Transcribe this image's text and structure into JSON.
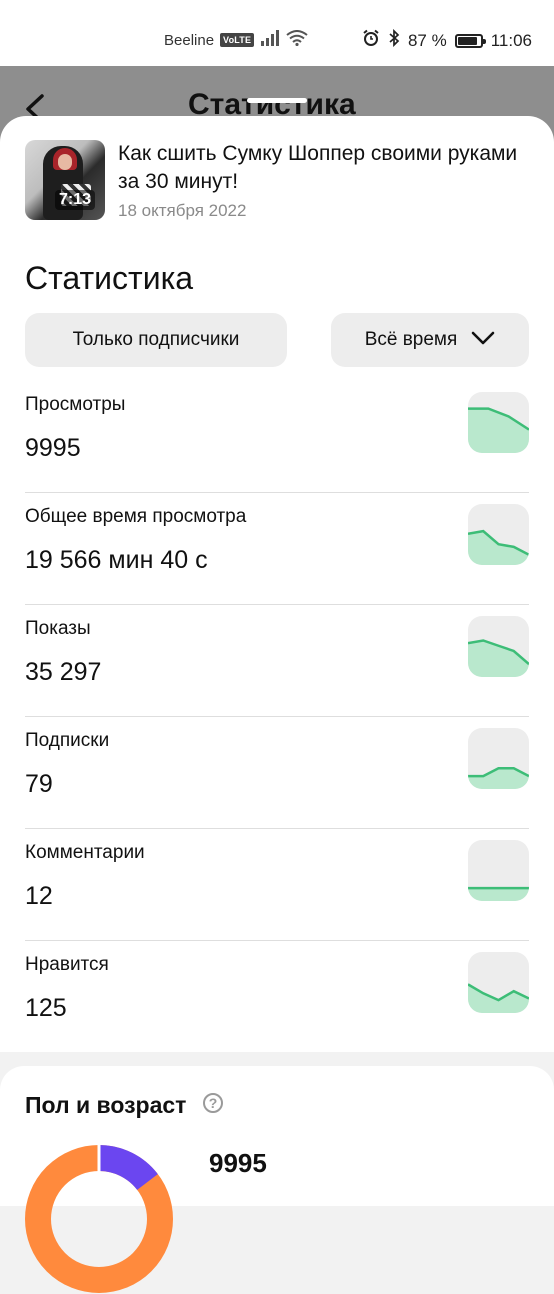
{
  "status_bar": {
    "carrier": "Beeline",
    "volte": "VoLTE",
    "battery": "87 %",
    "battery_level": 0.87,
    "time": "11:06"
  },
  "header": {
    "title": "Статистика"
  },
  "video": {
    "title": "Как сшить Сумку Шоппер своими руками за 30 минут!",
    "date": "18 октября 2022",
    "duration": "7:13"
  },
  "stats": {
    "title": "Статистика",
    "filter_audience": "Только подписчики",
    "filter_period": "Всё время",
    "items": [
      {
        "label": "Просмотры",
        "value": "9995",
        "trend": [
          0.75,
          0.75,
          0.6,
          0.35
        ]
      },
      {
        "label": "Общее время просмотра",
        "value": "19 566 мин 40 с",
        "trend": [
          0.5,
          0.55,
          0.3,
          0.25,
          0.1
        ]
      },
      {
        "label": "Показы",
        "value": "35 297",
        "trend": [
          0.55,
          0.6,
          0.5,
          0.4,
          0.15
        ]
      },
      {
        "label": "Подписки",
        "value": "79",
        "trend": [
          0.15,
          0.15,
          0.3,
          0.3,
          0.15
        ]
      },
      {
        "label": "Комментарии",
        "value": "12",
        "trend": [
          0.15,
          0.15,
          0.15,
          0.15
        ]
      },
      {
        "label": "Нравится",
        "value": "125",
        "trend": [
          0.45,
          0.28,
          0.15,
          0.32,
          0.18
        ]
      }
    ]
  },
  "demographics": {
    "title": "Пол и возраст",
    "total": "9995",
    "colors": {
      "primary": "#6b46f0",
      "secondary": "#ff8a3d"
    }
  },
  "colors": {
    "accent_green": "#3dbd77",
    "accent_green_fill": "#b9e8cd"
  }
}
